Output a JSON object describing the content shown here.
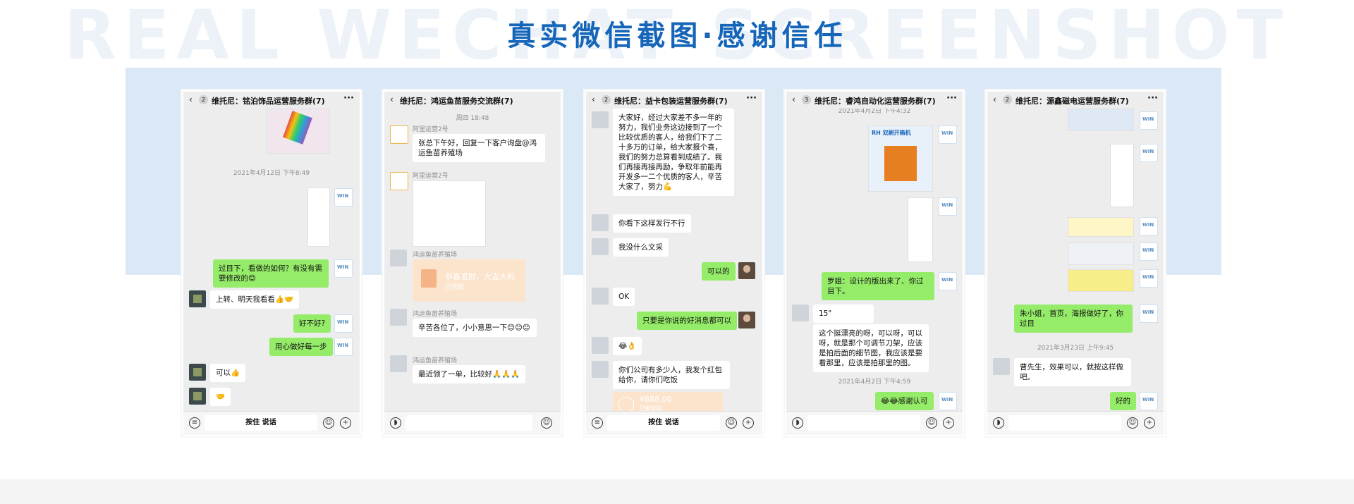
{
  "header": {
    "bg_text": "REAL WECHAT SCREENSHOT",
    "title": "真实微信截图·感谢信任"
  },
  "colors": {
    "title": "#1565b8",
    "band": "#dbe8f6",
    "bubble_green": "#95ec69"
  },
  "phones": [
    {
      "title": "维托尼：铭泊饰品运营服务群(7)",
      "count": "2",
      "input": "按住 说话",
      "time1": "2021年4月12日 下午8:49",
      "msgs": [
        "过目下，看做的如何？有没有需要修改的😊",
        "上转、明天我看看👍🤝",
        "好不好?",
        "用心做好每一步",
        "可以👍",
        "🤝"
      ]
    },
    {
      "title": "维托尼：鸿运鱼苗服务交流群(7)",
      "time1": "周四 18:48",
      "names": [
        "阿里运营2号",
        "阿里运营2号",
        "鸿运鱼苗养殖场",
        "鸿运鱼苗养殖场",
        "鸿运鱼苗养殖场"
      ],
      "msgs": [
        "张总下午好，回复一下客户询盘@鸿运鱼苗养殖场",
        "辛苦各位了，小小意思一下😊😊😊",
        "最近领了一单，比较好🙏🙏🙏"
      ],
      "redpacket": {
        "title": "恭喜发财，大吉大利",
        "sub": "已领取"
      }
    },
    {
      "title": "维托尼：益卡包装运营服务群(7)",
      "count": "2",
      "input": "按住 说话",
      "msgs": [
        "大家好，经过大家差不多一年的努力，我们业务这边接到了一个比较优质的客人，给我们下了二十多万的订单，给大家报个喜，我们的努力总算看到成绩了。我们再接再接再励，争取年前能再开发多一二个优质的客人，辛苦大家了，努力💪",
        "你看下这样发行不行",
        "我没什么文采",
        "可以的",
        "OK",
        "只要是你说的好消息都可以",
        "😂👌",
        "你们公司有多少人，我发个红包给你，请你们吃饭"
      ],
      "transfer": {
        "amount": "¥888.00",
        "sub": "已被领取"
      }
    },
    {
      "title": "维托尼：睿鸿自动化运营服务群(7)",
      "count": "3",
      "time0": "2021年4月2日 下午4:32",
      "banner": "RH 双刷开箱机",
      "msgs": [
        "罗姐：设计的版出来了、你过目下。",
        "15\"",
        "这个挺漂亮的呀，可以呀，可以呀，就是那个可调节刀架，应该是拍后面的细节图，我应该是要看那里，应该是拍那里的图。",
        "😂😂感谢认可"
      ],
      "time1": "2021年4月2日 下午4:59"
    },
    {
      "title": "维托尼：源鑫磁电运营服务群(7)",
      "count": "2",
      "msgs": [
        "朱小姐，首页，海报做好了，你过目",
        "曹先生，效果可以，就按这样做吧。",
        "好的"
      ],
      "time1": "2021年3月23日 上午9:45"
    }
  ]
}
